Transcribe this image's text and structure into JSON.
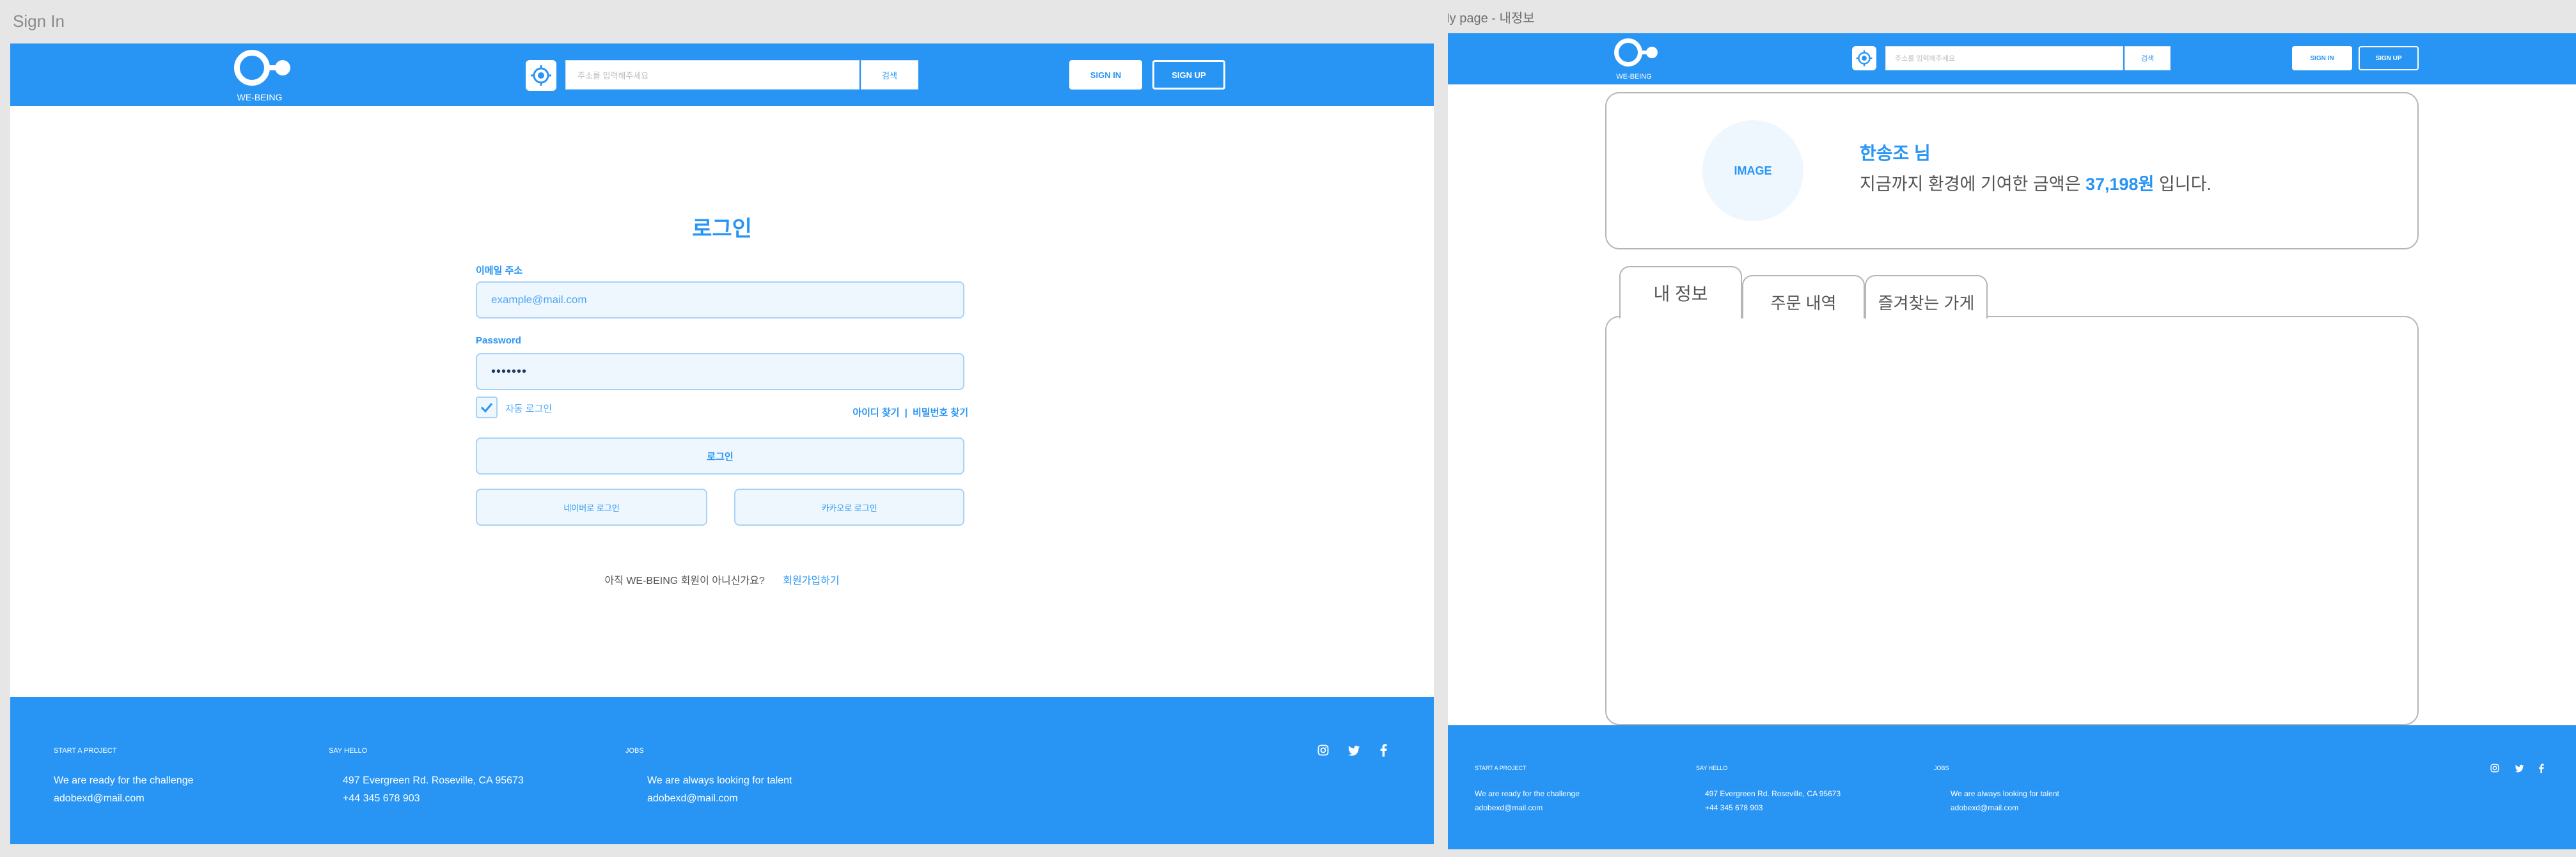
{
  "signin_frame": {
    "title": "Sign In",
    "header": {
      "logo_text": "WE-BEING",
      "search_placeholder": "주소를 입력해주세요",
      "search_button": "검색",
      "sign_in": "SIGN IN",
      "sign_up": "SIGN UP"
    },
    "form": {
      "heading": "로그인",
      "email_label": "이메일 주소",
      "email_placeholder": "example@mail.com",
      "password_label": "Password",
      "password_value": "•••••••",
      "auto_login": "자동 로그인",
      "find_id": "아이디 찾기",
      "divider": "|",
      "find_password": "비밀번호 찾기",
      "login_button": "로그인",
      "naver_login": "네이버로 로그인",
      "kakao_login": "카카오로 로그인",
      "not_member": "아직 WE-BEING 회원이 아니신가요?",
      "signup_link": "회원가입하기"
    }
  },
  "mypage_frame": {
    "title": "My page - 내정보",
    "header": {
      "logo_text": "WE-BEING",
      "search_placeholder": "주소를 입력해주세요",
      "search_button": "검색",
      "sign_in": "SIGN IN",
      "sign_up": "SIGN UP"
    },
    "profile": {
      "image_placeholder": "IMAGE",
      "user_name": "한송조 님",
      "contribution_prefix": "지금까지 환경에 기여한 금액은",
      "contribution_amount": "37,198원",
      "contribution_suffix": "입니다."
    },
    "tabs": [
      "내 정보",
      "주문 내역",
      "즐겨찾는 가게"
    ]
  },
  "footer": {
    "col1_heading": "START A PROJECT",
    "col1_line1": "We are ready for the challenge",
    "col1_line2": "adobexd@mail.com",
    "col2_heading": "SAY HELLO",
    "col2_line1": "497 Evergreen Rd. Roseville, CA 95673",
    "col2_line2": "+44 345 678 903",
    "col3_heading": "JOBS",
    "col3_line1": "We are always looking for talent",
    "col3_line2": "adobexd@mail.com",
    "social_icons": [
      "instagram-icon",
      "twitter-icon",
      "facebook-icon"
    ]
  },
  "colors": {
    "brand_blue": "#2895f4",
    "canvas_gray": "#e6e6e6",
    "field_fill": "#eef6fe",
    "field_border": "#a9d2f7"
  }
}
